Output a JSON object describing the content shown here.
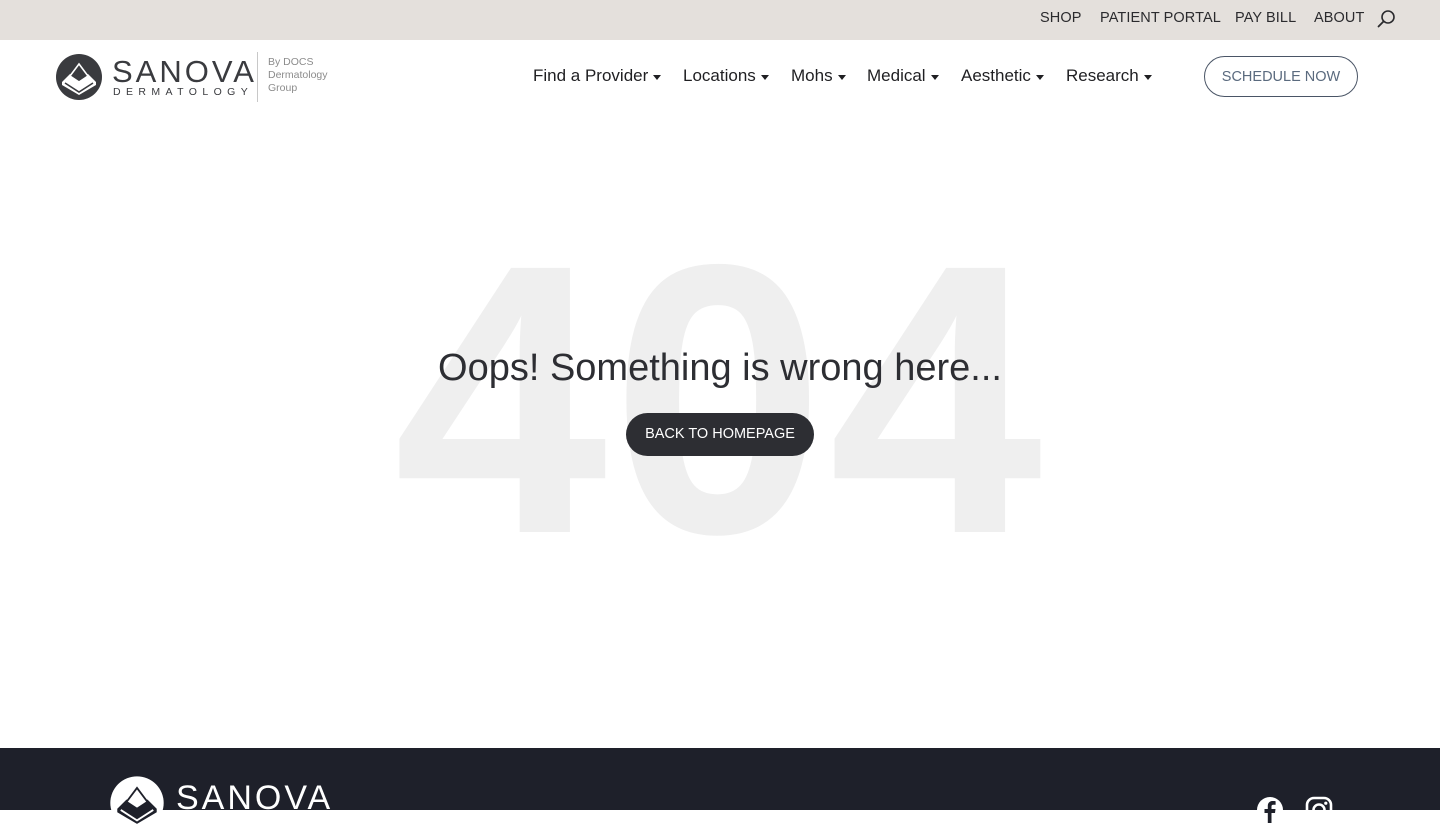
{
  "topbar": {
    "links": [
      "SHOP",
      "PATIENT PORTAL",
      "PAY BILL",
      "ABOUT"
    ],
    "search_icon": "search-icon"
  },
  "brand": {
    "name": "SANOVA",
    "sub": "DERMATOLOGY",
    "by_line1": "By DOCS",
    "by_line2": "Dermatology",
    "by_line3": "Group"
  },
  "nav": {
    "items": [
      "Find a Provider",
      "Locations",
      "Mohs",
      "Medical",
      "Aesthetic",
      "Research"
    ],
    "cta": "SCHEDULE NOW"
  },
  "error": {
    "code": "404",
    "message": "Oops! Something is wrong here...",
    "button": "BACK TO HOMEPAGE"
  },
  "footer": {
    "brand": "SANOVA",
    "social": [
      "facebook-icon",
      "instagram-icon"
    ]
  },
  "colors": {
    "topbar_bg": "#e4e0dc",
    "footer_bg": "#1e202a",
    "button_dark": "#2d2e33",
    "cta_border": "#4a5566"
  }
}
